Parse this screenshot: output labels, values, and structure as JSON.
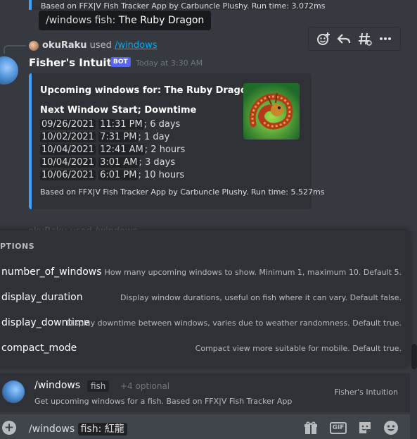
{
  "top_embed": {
    "footer": "Based on FFX|V Fish Tracker App by Carbuncle Plushy. Run time: 3.072ms"
  },
  "tooltip": {
    "command": "/windows",
    "param": "fish:",
    "value": "The Ruby Dragon"
  },
  "hover_actions": [
    "add-reaction-icon",
    "reply-icon",
    "create-thread-icon",
    "more-icon"
  ],
  "reply": {
    "user": "okuRaku",
    "verb": "used",
    "command": "/windows"
  },
  "message": {
    "author": "Fisher's Intuition",
    "badge": "BOT",
    "timestamp": "Today at 3:30 AM",
    "embed": {
      "title": "Upcoming windows for: The Ruby Dragon",
      "field_name": "Next Window Start; Downtime",
      "rows": [
        {
          "date": "09/26/2021",
          "time": "11:31 PM",
          "downtime": "; 6 days"
        },
        {
          "date": "10/02/2021",
          "time": "7:31 PM",
          "downtime": "; 1 day"
        },
        {
          "date": "10/04/2021",
          "time": "12:41 AM",
          "downtime": "; 2 hours"
        },
        {
          "date": "10/04/2021",
          "time": "3:01 AM",
          "downtime": "; 3 days"
        },
        {
          "date": "10/06/2021",
          "time": "6:01 PM",
          "downtime": "; 10 hours"
        }
      ],
      "footer": "Based on FFX|V Fish Tracker App by Carbuncle Plushy. Run time: 5.527ms"
    }
  },
  "faded_reply": "okuRaku used /windows",
  "options": {
    "header": "PTIONS",
    "items": [
      {
        "name": "number_of_windows",
        "desc": "How many upcoming windows to show. Minimum 1, maximum 10. Default 5."
      },
      {
        "name": "display_duration",
        "desc": "Display window durations, useful on fish where it can vary. Default false."
      },
      {
        "name": "display_downtime",
        "desc": "Display downtime between windows, varies due to weather randomness. Default true."
      },
      {
        "name": "compact_mode",
        "desc": "Compact view more suitable for mobile. Default true."
      }
    ]
  },
  "command_suggestion": {
    "name": "/windows",
    "param": "fish",
    "optional": "+4 optional",
    "bot": "Fisher's Intuition",
    "description": "Get upcoming windows for a fish. Based on FFX|V Fish Tracker App"
  },
  "input": {
    "command": "/windows",
    "param_label": "fish:",
    "param_value": "紅龍"
  },
  "input_icons": [
    "gift-icon",
    "gif-icon",
    "sticker-icon",
    "emoji-icon"
  ],
  "colors": {
    "accent": "#3ba2ff",
    "bot_badge": "#5865f2",
    "link": "#00aff4"
  }
}
